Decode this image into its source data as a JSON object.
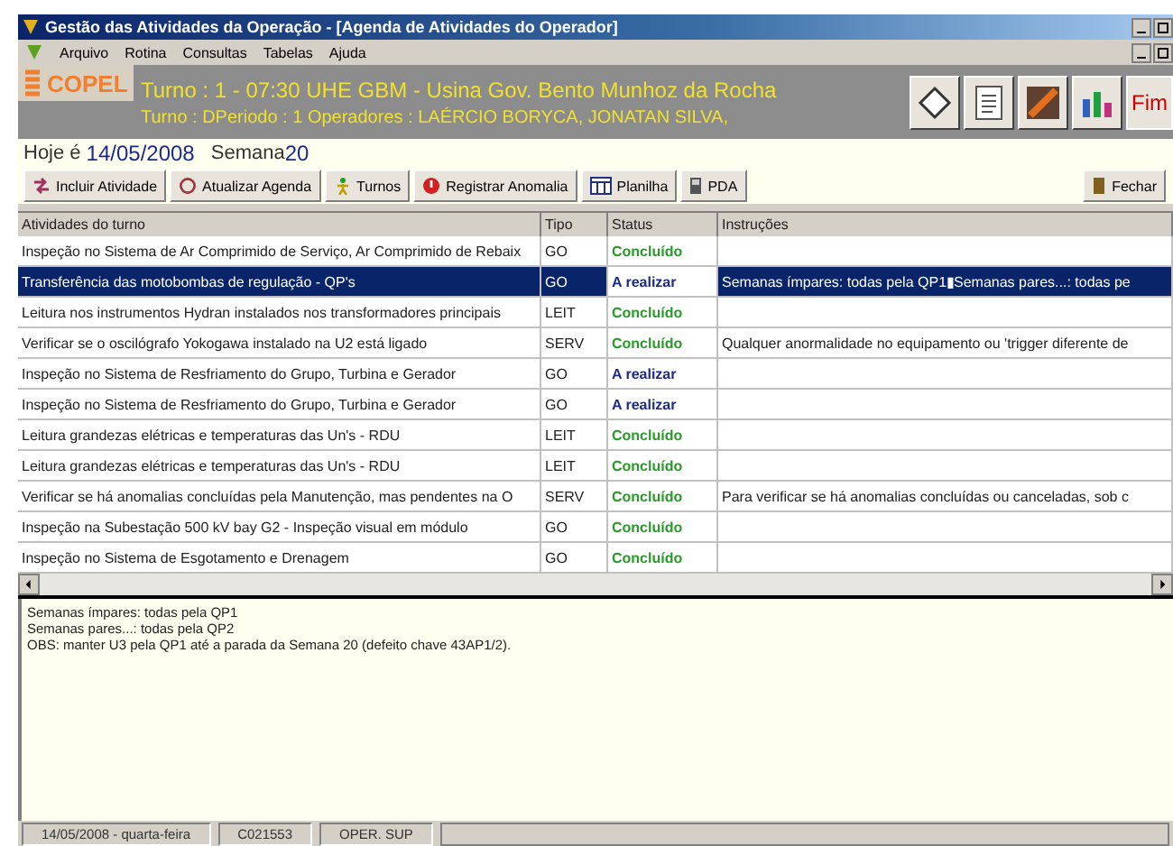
{
  "window": {
    "title": "Gestão das Atividades da Operação - [Agenda de Atividades do Operador]"
  },
  "menu": [
    "Arquivo",
    "Rotina",
    "Consultas",
    "Tabelas",
    "Ajuda"
  ],
  "header": {
    "brand": "COPEL",
    "line1": "Turno : 1 - 07:30   UHE GBM - Usina Gov. Bento Munhoz da Rocha",
    "line2": "Turno : DPeriodo : 1 Operadores : LAÉRCIO BORYCA, JONATAN SILVA,",
    "exit": "Fim"
  },
  "date": {
    "prefix": "Hoje é",
    "date": "14/05/2008",
    "week_label": "Semana",
    "week": "20"
  },
  "toolbar": [
    {
      "label": "Incluir Atividade",
      "kind": "add"
    },
    {
      "label": "Atualizar Agenda",
      "kind": "refresh"
    },
    {
      "label": "Turnos",
      "kind": "person"
    },
    {
      "label": "Registrar Anomalia",
      "kind": "alert"
    },
    {
      "label": "Planilha",
      "kind": "sheet"
    },
    {
      "label": "PDA",
      "kind": "device"
    }
  ],
  "close_button": "Fechar",
  "table": {
    "columns": [
      "Atividades do turno",
      "Tipo",
      "Status",
      "Instruções"
    ],
    "rows": [
      {
        "activity": "Inspeção no Sistema de Ar Comprimido de Serviço, Ar Comprimido de Rebaix",
        "type": "GO",
        "status": "Concluído",
        "done": true,
        "instructions": "",
        "selected": false
      },
      {
        "activity": "Transferência das motobombas de regulação - QP's",
        "type": "GO",
        "status": "A realizar",
        "done": false,
        "instructions": "Semanas ímpares: todas pela QP1▮Semanas pares...: todas pe",
        "selected": true
      },
      {
        "activity": "Leitura nos instrumentos Hydran instalados nos transformadores principais",
        "type": "LEIT",
        "status": "Concluído",
        "done": true,
        "instructions": "",
        "selected": false
      },
      {
        "activity": "Verificar se o oscilógrafo Yokogawa instalado na U2 está ligado",
        "type": "SERV",
        "status": "Concluído",
        "done": true,
        "instructions": "Qualquer anormalidade no equipamento ou 'trigger diferente de",
        "selected": false
      },
      {
        "activity": "Inspeção no Sistema de Resfriamento do Grupo, Turbina e Gerador",
        "type": "GO",
        "status": "A realizar",
        "done": false,
        "instructions": "",
        "selected": false
      },
      {
        "activity": "Inspeção no Sistema de Resfriamento do Grupo, Turbina e Gerador",
        "type": "GO",
        "status": "A realizar",
        "done": false,
        "instructions": "",
        "selected": false
      },
      {
        "activity": "Leitura grandezas elétricas e temperaturas das Un's - RDU",
        "type": "LEIT",
        "status": "Concluído",
        "done": true,
        "instructions": "",
        "selected": false
      },
      {
        "activity": "Leitura grandezas elétricas e temperaturas das Un's - RDU",
        "type": "LEIT",
        "status": "Concluído",
        "done": true,
        "instructions": "",
        "selected": false
      },
      {
        "activity": "Verificar se há anomalias concluídas pela Manutenção, mas pendentes na O",
        "type": "SERV",
        "status": "Concluído",
        "done": true,
        "instructions": "Para verificar se há anomalias concluídas ou canceladas, sob c",
        "selected": false
      },
      {
        "activity": "Inspeção na Subestação 500 kV bay G2 - Inspeção visual em módulo",
        "type": "GO",
        "status": "Concluído",
        "done": true,
        "instructions": "",
        "selected": false
      },
      {
        "activity": "Inspeção no Sistema de Esgotamento e Drenagem",
        "type": "GO",
        "status": "Concluído",
        "done": true,
        "instructions": "",
        "selected": false
      }
    ]
  },
  "notes": [
    "Semanas ímpares: todas pela QP1",
    "Semanas pares...: todas pela QP2",
    "OBS: manter U3 pela QP1 até a parada da Semana 20 (defeito chave 43AP1/2)."
  ],
  "status_bar": [
    "14/05/2008 - quarta-feira",
    "C021553",
    "OPER. SUP"
  ]
}
